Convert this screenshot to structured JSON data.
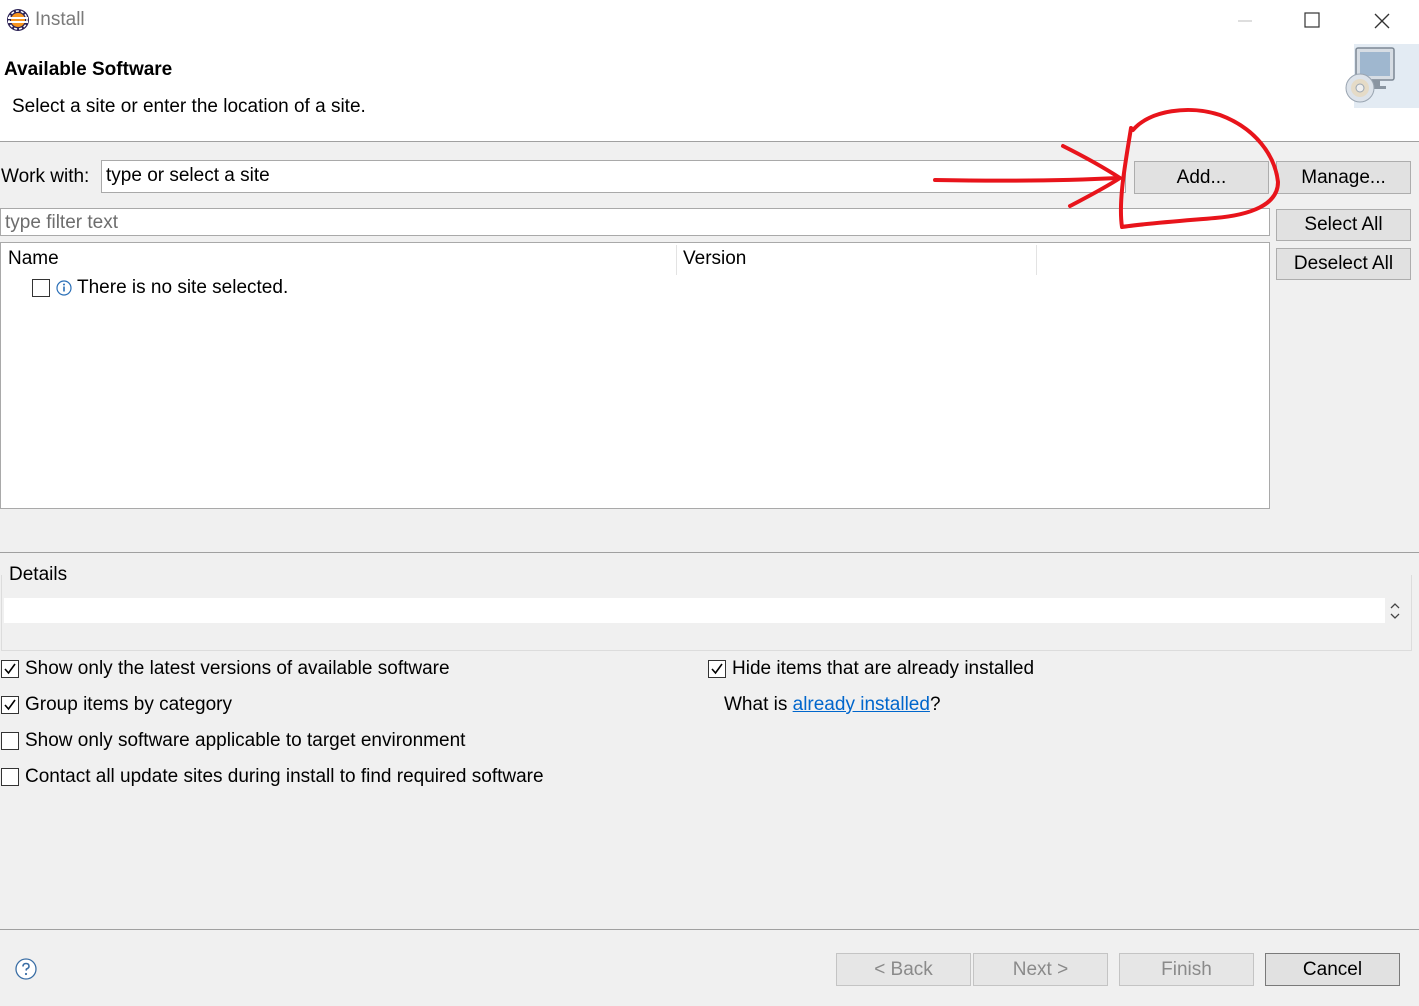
{
  "window": {
    "title": "Install",
    "icon": "eclipse-icon",
    "controls": [
      "minimize-icon",
      "maximize-icon",
      "close-icon"
    ]
  },
  "banner": {
    "title": "Available Software",
    "subtitle": "Select a site or enter the location of a site.",
    "icon": "install-software-icon"
  },
  "work_with": {
    "label": "Work with:",
    "value": "type or select a site",
    "add_label": "Add...",
    "manage_label": "Manage..."
  },
  "filter": {
    "placeholder": "type filter text"
  },
  "side_buttons": {
    "select_all": "Select All",
    "deselect_all": "Deselect All"
  },
  "table": {
    "columns": [
      "Name",
      "Version"
    ],
    "rows": [
      {
        "checked": false,
        "icon": "info-icon",
        "name": "There is no site selected."
      }
    ]
  },
  "details": {
    "label": "Details"
  },
  "options": {
    "left": [
      {
        "label": "Show only the latest versions of available software",
        "checked": true
      },
      {
        "label": "Group items by category",
        "checked": true
      },
      {
        "label": "Show only software applicable to target environment",
        "checked": false
      },
      {
        "label": "Contact all update sites during install to find required software",
        "checked": false
      }
    ],
    "right": [
      {
        "label": "Hide items that are already installed",
        "checked": true
      }
    ],
    "installed_prefix": "What is ",
    "installed_link": "already installed",
    "installed_suffix": "?"
  },
  "footer": {
    "help_icon": "help-icon",
    "back": "< Back",
    "next": "Next >",
    "finish": "Finish",
    "cancel": "Cancel"
  },
  "annotation": {
    "color": "#e8141b"
  }
}
